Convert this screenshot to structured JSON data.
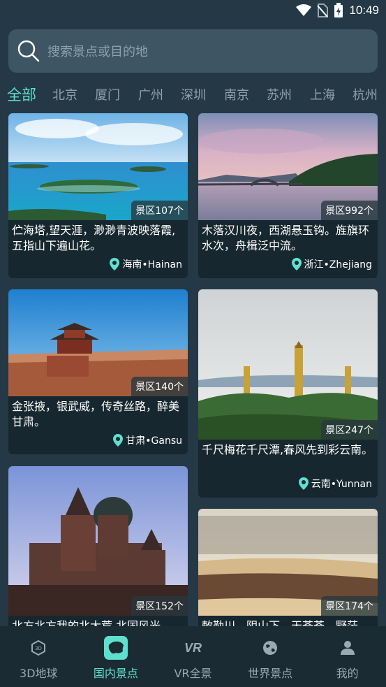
{
  "status": {
    "time": "10:49"
  },
  "search": {
    "placeholder": "搜索景点或目的地"
  },
  "city_tabs": [
    "全部",
    "北京",
    "厦门",
    "广州",
    "深圳",
    "南京",
    "苏州",
    "上海",
    "杭州"
  ],
  "city_tabs_active": "全部",
  "cards": [
    {
      "count": "景区107个",
      "text": "伫海塔,望天涯，渺渺青波映落霞,五指山下遍山花。",
      "location": "海南•Hainan",
      "scene": "island-sea"
    },
    {
      "count": "景区992个",
      "text": "木落汉川夜，西湖悬玉钩。旌旗环水次，舟楫泛中流。",
      "location": "浙江•Zhejiang",
      "scene": "lake-bridge-sunset"
    },
    {
      "count": "景区140个",
      "text": "金张掖，银武威，传奇丝路，醉美甘肃。",
      "location": "甘肃•Gansu",
      "scene": "fortress-wall"
    },
    {
      "count": "景区247个",
      "text": "千尺梅花千尺潭,春风先到彩云南。",
      "location": "云南•Yunnan",
      "scene": "three-pagodas"
    },
    {
      "count": "景区152个",
      "text": "北方北方我的北大荒 北国风光",
      "location": "",
      "scene": "onion-dome-cathedral"
    },
    {
      "count": "景区174个",
      "text": "敕勒川，阴山下，天苍苍，野茫",
      "location": "",
      "scene": "horses-grassland"
    }
  ],
  "nav": [
    {
      "label": "3D地球",
      "icon": "cube-3d-icon",
      "active": false
    },
    {
      "label": "国内景点",
      "icon": "china-map-icon",
      "active": true
    },
    {
      "label": "VR全景",
      "icon": "vr-icon",
      "active": false
    },
    {
      "label": "世界景点",
      "icon": "globe-icon",
      "active": false
    },
    {
      "label": "我的",
      "icon": "user-icon",
      "active": false
    }
  ],
  "colors": {
    "accent": "#5ee0cf",
    "background": "#243845",
    "search_bg": "#3e5664",
    "nav_bg": "#1b2b33"
  }
}
